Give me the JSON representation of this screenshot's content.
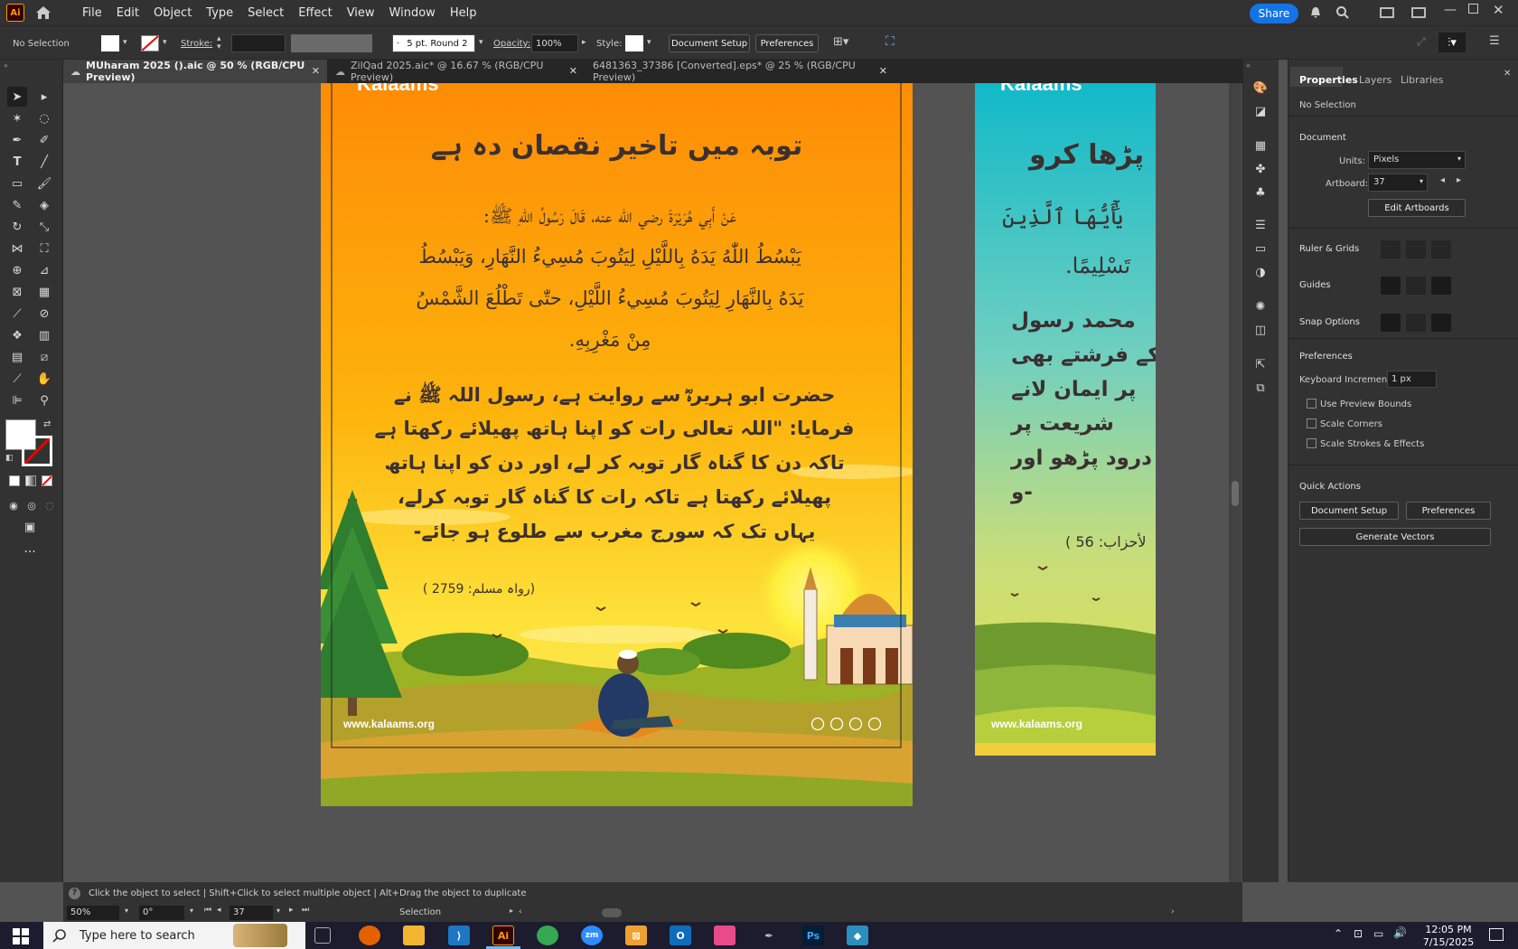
{
  "app": {
    "logo": "Ai",
    "home_icon": "home-icon"
  },
  "menu": [
    "File",
    "Edit",
    "Object",
    "Type",
    "Select",
    "Effect",
    "View",
    "Window",
    "Help"
  ],
  "share_label": "Share",
  "control": {
    "selection": "No Selection",
    "stroke_label": "Stroke:",
    "brush": "5 pt. Round 2",
    "opacity_label": "Opacity:",
    "opacity": "100%",
    "style_label": "Style:",
    "doc_setup": "Document Setup",
    "preferences": "Preferences"
  },
  "tabs": [
    {
      "label": "MUharam 2025 ().aic @ 50 % (RGB/CPU Preview)"
    },
    {
      "label": "ZilQad 2025.aic* @ 16.67 % (RGB/CPU Preview)"
    },
    {
      "label": "6481363_37386 [Converted].eps* @ 25 % (RGB/CPU Preview)"
    }
  ],
  "art1": {
    "brand": "Kalaams",
    "title": "توبہ میں تاخیر نقصان دہ ہے",
    "arabic": [
      "عَنْ أَبِي هُرَيْرَةَ رضي الله عنه، قَالَ رَسُولُ اللّٰهِ ﷺ:",
      "يَبْسُطُ اللّٰهُ يَدَهُ بِاللَّيْلِ لِيَتُوبَ مُسِيءُ النَّهَارِ، وَيَبْسُطُ",
      "يَدَهُ بِالنَّهَارِ لِيَتُوبَ مُسِيءُ اللَّيْلِ، حتّٰى تَطْلُعَ الشَّمْسُ",
      "مِنْ مَغْرِبِهِ."
    ],
    "urdu": [
      "حضرت ابو ہریرہؓ سے روایت ہے، رسول اللہ ﷺ نے",
      "فرمایا: \"اللہ تعالی رات کو اپنا ہاتھ پھیلائے رکھتا ہے",
      "تاکہ دن کا گناہ گار توبہ کر لے، اور دن کو اپنا ہاتھ",
      "پھیلائے رکھتا ہے تاکہ رات کا گناہ گار توبہ کرلے،",
      "یہاں تک کہ سورج مغرب سے طلوع ہو جائے-"
    ],
    "reference": "(رواہ مسلم: 2759 )",
    "website": "www.kalaams.org"
  },
  "art2": {
    "brand": "Kalaams",
    "title": "پڑھا کرو",
    "arabic": [
      "يَٰٓأَيُّهَا ٱلَّذِينَ",
      "تَسْلِيمًا."
    ],
    "urdu": [
      "محمد رسول",
      "کے فرشتے بھی",
      "پر ایمان لانے",
      "شریعت پر",
      "درود پڑھو اور",
      "-و"
    ],
    "reference": "لأحزاب: 56 )",
    "website": "www.kalaams.org"
  },
  "panel": {
    "tabs": [
      "Properties",
      "Layers",
      "Libraries"
    ],
    "no_selection": "No Selection",
    "document": "Document",
    "units_label": "Units:",
    "units": "Pixels",
    "artboard_label": "Artboard:",
    "artboard": "37",
    "edit_artboards": "Edit Artboards",
    "rulers": "Ruler & Grids",
    "guides": "Guides",
    "snap": "Snap Options",
    "preferences": "Preferences",
    "keyboard_label": "Keyboard Increment:",
    "keyboard": "1 px",
    "checks": [
      "Use Preview Bounds",
      "Scale Corners",
      "Scale Strokes & Effects"
    ],
    "quick_actions": "Quick Actions",
    "doc_setup": "Document Setup",
    "prefs": "Preferences",
    "generate": "Generate Vectors"
  },
  "status": {
    "hint": "Click the object to select  |  Shift+Click to select multiple object  |  Alt+Drag the object to duplicate",
    "zoom": "50%",
    "rotate": "0°",
    "artboard": "37",
    "tool": "Selection"
  },
  "taskbar": {
    "search": "Type here to search",
    "time": "12:05 PM",
    "date": "7/15/2025"
  }
}
